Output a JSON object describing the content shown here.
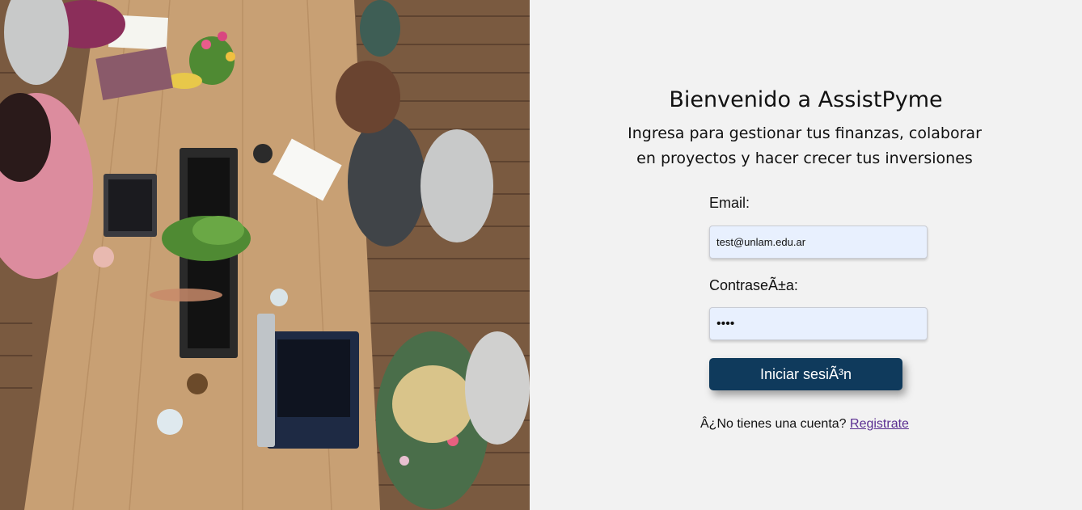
{
  "image": {
    "alt": "Personas trabajando en una mesa compartida"
  },
  "header": {
    "title": "Bienvenido a AssistPyme",
    "subtitle": "Ingresa para gestionar tus finanzas, colaborar en proyectos y hacer crecer tus inversiones"
  },
  "form": {
    "email_label": "Email:",
    "email_value": "test@unlam.edu.ar",
    "password_label": "ContraseÃ±a:",
    "password_value": "1234",
    "submit_label": "Iniciar sesiÃ³n"
  },
  "signup": {
    "prompt": "Â¿No tienes una cuenta?",
    "link": "Registrate"
  },
  "colors": {
    "button_bg": "#0f3a5c",
    "input_bg": "#e8f0fe",
    "link": "#5a2d91",
    "panel_bg": "#f2f2f2"
  }
}
